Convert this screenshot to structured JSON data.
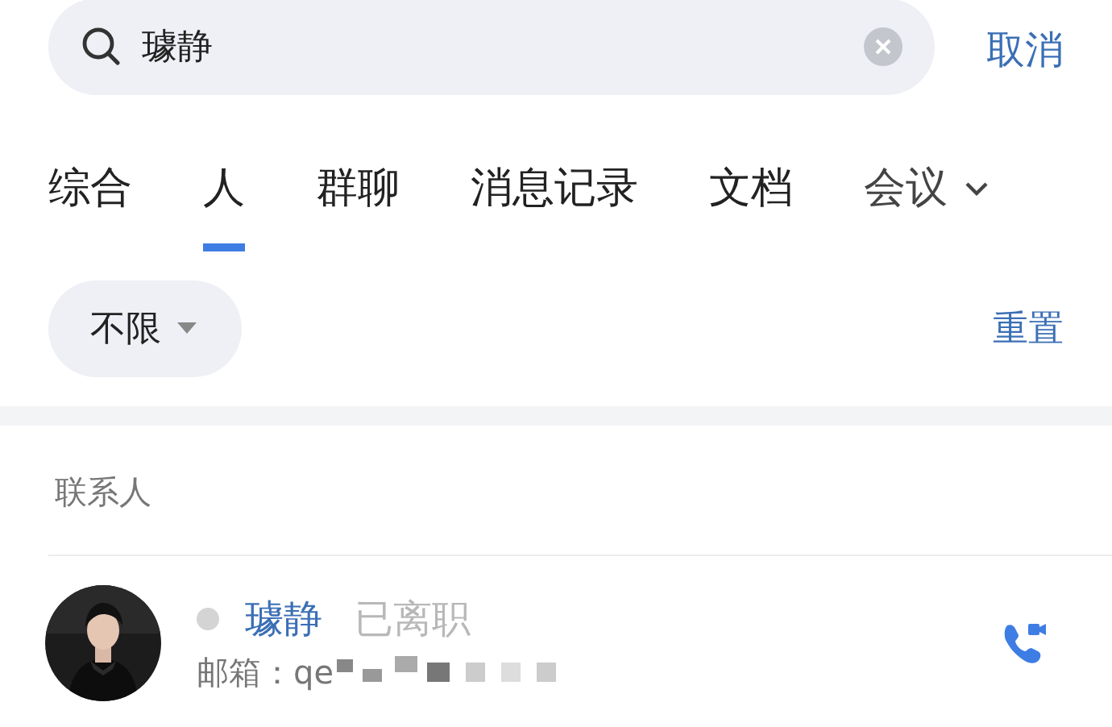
{
  "search": {
    "value": "璩静",
    "cancel": "取消"
  },
  "tabs": [
    {
      "label": "综合",
      "selected": false
    },
    {
      "label": "人",
      "selected": true
    },
    {
      "label": "群聊",
      "selected": false
    },
    {
      "label": "消息记录",
      "selected": false
    },
    {
      "label": "文档",
      "selected": false
    },
    {
      "label": "会议",
      "selected": false
    }
  ],
  "filter": {
    "label": "不限",
    "reset": "重置"
  },
  "section_title": "联系人",
  "contacts": [
    {
      "name": "璩静",
      "status": "已离职",
      "email_label": "邮箱：",
      "email": "qe"
    }
  ]
}
